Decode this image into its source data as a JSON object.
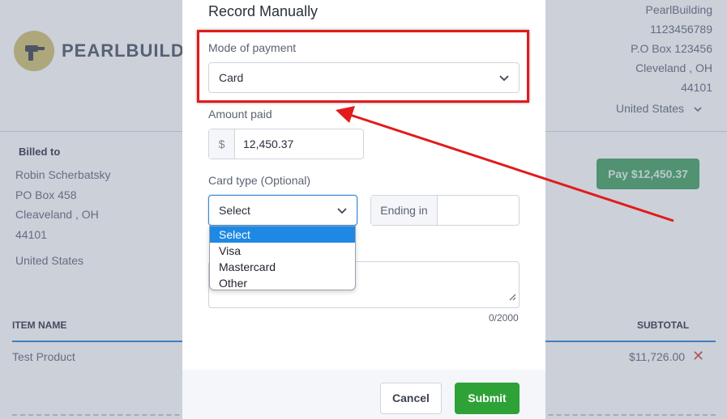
{
  "background": {
    "brand_name": "PEARLBUILDI",
    "company": {
      "name": "PearlBuilding",
      "phone": "1123456789",
      "address": "P.O Box 123456",
      "city_state": "Cleveland , OH",
      "zip": "44101"
    },
    "country_select": {
      "value": "United States"
    },
    "billed_to": {
      "title": "Billed to",
      "name": "Robin Scherbatsky",
      "address": "PO Box 458",
      "city_state": "Cleaveland , OH",
      "zip": "44101",
      "country": "United States"
    },
    "pay_button": "Pay $12,450.37",
    "table": {
      "col_item": "ITEM NAME",
      "col_subtotal": "SUBTOTAL",
      "rows": [
        {
          "name": "Test Product",
          "subtotal": "$11,726.00"
        }
      ]
    }
  },
  "modal": {
    "title": "Record Manually",
    "mode_of_payment": {
      "label": "Mode of payment",
      "value": "Card"
    },
    "amount": {
      "label": "Amount paid",
      "currency_symbol": "$",
      "value": "12,450.37"
    },
    "card_type": {
      "label": "Card type (Optional)",
      "value": "Select",
      "options": [
        "Select",
        "Visa",
        "Mastercard",
        "Other"
      ]
    },
    "ending_in": {
      "label": "Ending in",
      "value": ""
    },
    "notes": {
      "counter": "0/2000"
    },
    "cancel_label": "Cancel",
    "submit_label": "Submit"
  },
  "colors": {
    "annotation_red": "#e11b1b",
    "submit_green": "#2ea236",
    "pay_green": "#4fa76a",
    "dropdown_selected": "#1e88e5"
  },
  "icons": {
    "logo": "drill-icon",
    "chevron": "chevron-down-icon",
    "delete": "close-icon"
  }
}
